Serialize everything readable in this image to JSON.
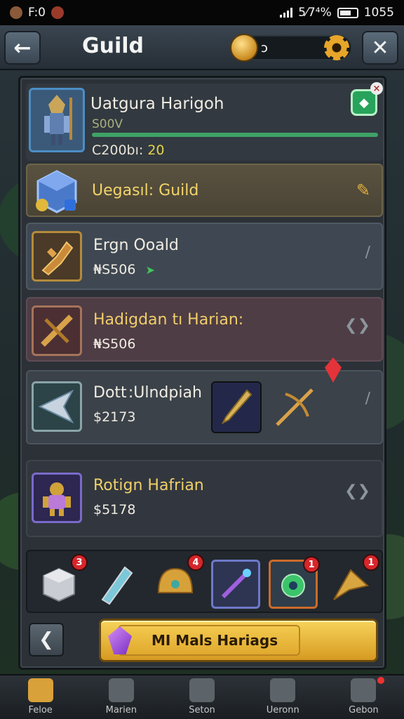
{
  "status_bar": {
    "left_text": "F:0",
    "signal_text": "5⁄7⁴%",
    "time": "1055"
  },
  "header": {
    "title": "Guild",
    "currency_value": "ɔ",
    "back_icon": "back-arrow-icon",
    "close_icon": "close-icon",
    "settings_icon": "gear-icon"
  },
  "player": {
    "name": "Uatgura Harigoh",
    "progress_label": "S00V",
    "progress_fraction": 1.0,
    "stat_label": "C200bı:",
    "stat_value": "20"
  },
  "guild_row": {
    "name": "Uegasıl: Guild"
  },
  "rows": [
    {
      "name": "Ergn Ooald",
      "price": "₦S506"
    },
    {
      "name": "Hadigdan tı Harian:",
      "price": "₦S506"
    },
    {
      "name": "Dott :Ulndpiah",
      "price": "$2173"
    },
    {
      "name": "Rotign Hafrian",
      "price": "$5178"
    }
  ],
  "inventory": {
    "slots": [
      {
        "icon": "crate-icon",
        "badge": "3",
        "style": "boxed"
      },
      {
        "icon": "potion-icon",
        "badge": "",
        "style": "plain"
      },
      {
        "icon": "helmet-icon",
        "badge": "4",
        "style": "plain"
      },
      {
        "icon": "staff-icon",
        "badge": "",
        "style": "boxed blue"
      },
      {
        "icon": "lantern-icon",
        "badge": "1",
        "style": "boxed orange"
      },
      {
        "icon": "arrowhead-icon",
        "badge": "1",
        "style": "plain"
      }
    ]
  },
  "action": {
    "button_label": "MI  Mals Hariags"
  },
  "bottom_nav": [
    {
      "label": "Feloe",
      "active": true
    },
    {
      "label": "Marien",
      "active": false
    },
    {
      "label": "Seton",
      "active": false
    },
    {
      "label": "Ueronn",
      "active": false
    },
    {
      "label": "Gebon",
      "active": false
    }
  ],
  "colors": {
    "accent_gold": "#e7a62a",
    "progress_green": "#3fa267",
    "badge_red": "#d6262b"
  }
}
